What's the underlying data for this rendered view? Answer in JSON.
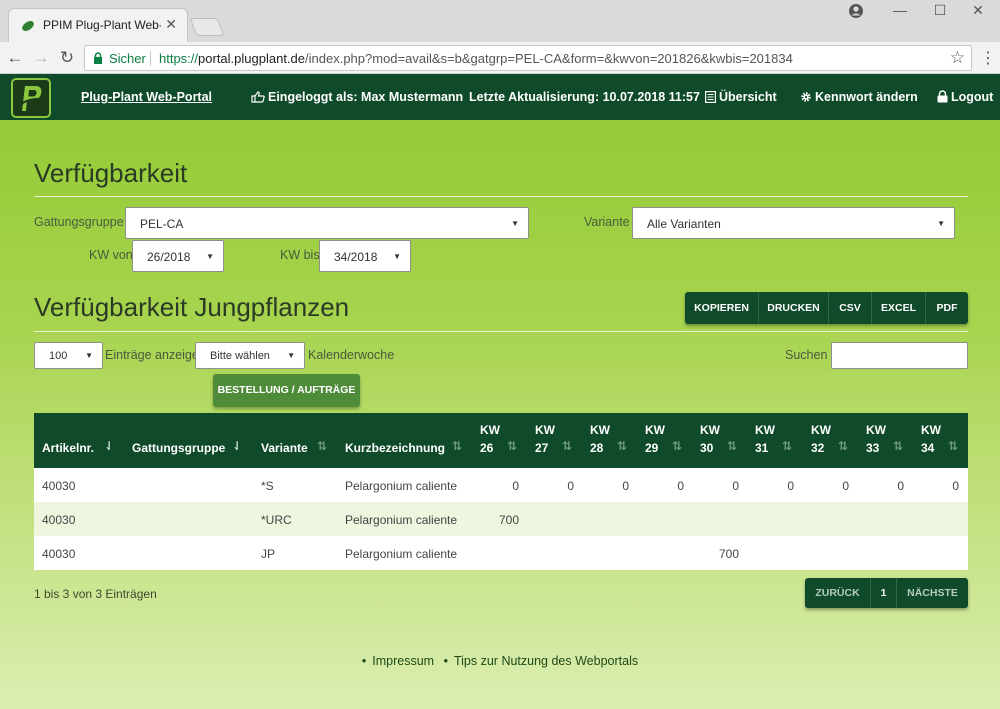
{
  "browser": {
    "tab_title": "PPIM Plug-Plant Web-Por",
    "tab_close": "✕",
    "secure_label": "Sicher",
    "url_scheme": "https://",
    "url_host": "portal.plugplant.de",
    "url_path": "/index.php?mod=avail&s=b&gatgrp=PEL-CA&form=&kwvon=201826&kwbis=201834",
    "back": "←",
    "forward": "→",
    "reload": "↻",
    "star": "☆",
    "menu": "⋮",
    "minimize": "—",
    "maximize": "☐",
    "close": "✕"
  },
  "header": {
    "brand": "Plug-Plant Web-Portal",
    "logged_in": "Eingeloggt als: Max Mustermann",
    "last_update": "Letzte Aktualisierung: 10.07.2018 11:57",
    "overview": "Übersicht",
    "change_password": "Kennwort ändern",
    "logout": "Logout"
  },
  "filters": {
    "title": "Verfügbarkeit",
    "genus_group_label": "Gattungsgruppe",
    "genus_group_value": "PEL-CA",
    "variant_label": "Variante",
    "variant_value": "Alle Varianten",
    "kw_from_label": "KW von",
    "kw_from_value": "26/2018",
    "kw_to_label": "KW bis",
    "kw_to_value": "34/2018",
    "caret": "▼"
  },
  "table_section": {
    "title": "Verfügbarkeit Jungpflanzen",
    "export_buttons": [
      "KOPIEREN",
      "DRUCKEN",
      "CSV",
      "EXCEL",
      "PDF"
    ],
    "page_length_value": "100",
    "page_length_suffix": "Einträge anzeige",
    "week_select_value": "Bitte wählen",
    "week_select_suffix": "Kalenderwoche",
    "search_label": "Suchen",
    "order_button": "BESTELLUNG / AUFTRÄGE"
  },
  "table": {
    "sort_glyph": "⇅",
    "sort_active_glyph": "⇃",
    "col_article": "Artikelnr.",
    "col_group": "Gattungsgruppe",
    "col_variant": "Variante",
    "col_short": "Kurzbezeichnung",
    "kw_prefix": "KW",
    "weeks": [
      "26",
      "27",
      "28",
      "29",
      "30",
      "31",
      "32",
      "33",
      "34"
    ],
    "rows": [
      {
        "article": "40030",
        "group": "",
        "variant": "*S",
        "short": "Pelargonium caliente",
        "w": [
          "0",
          "0",
          "0",
          "0",
          "0",
          "0",
          "0",
          "0",
          "0"
        ]
      },
      {
        "article": "40030",
        "group": "",
        "variant": "*URC",
        "short": "Pelargonium caliente",
        "w": [
          "700",
          "",
          "",
          "",
          "",
          "",
          "",
          "",
          ""
        ]
      },
      {
        "article": "40030",
        "group": "",
        "variant": "JP",
        "short": "Pelargonium caliente",
        "w": [
          "",
          "",
          "",
          "",
          "700",
          "",
          "",
          "",
          ""
        ]
      }
    ]
  },
  "pagination": {
    "info": "1 bis 3 von 3 Einträgen",
    "previous": "ZURÜCK",
    "current": "1",
    "next": "NÄCHSTE"
  },
  "footer": {
    "bullet": "•",
    "imprint": "Impressum",
    "tips": "Tips zur Nutzung des Webportals"
  },
  "colors": {
    "header_bg": "#0f4a2b",
    "page_green_top": "#94cb36",
    "page_green_bottom": "#dbeeb1",
    "button_green": "#4f8c3a",
    "secure_green": "#0b8043"
  }
}
